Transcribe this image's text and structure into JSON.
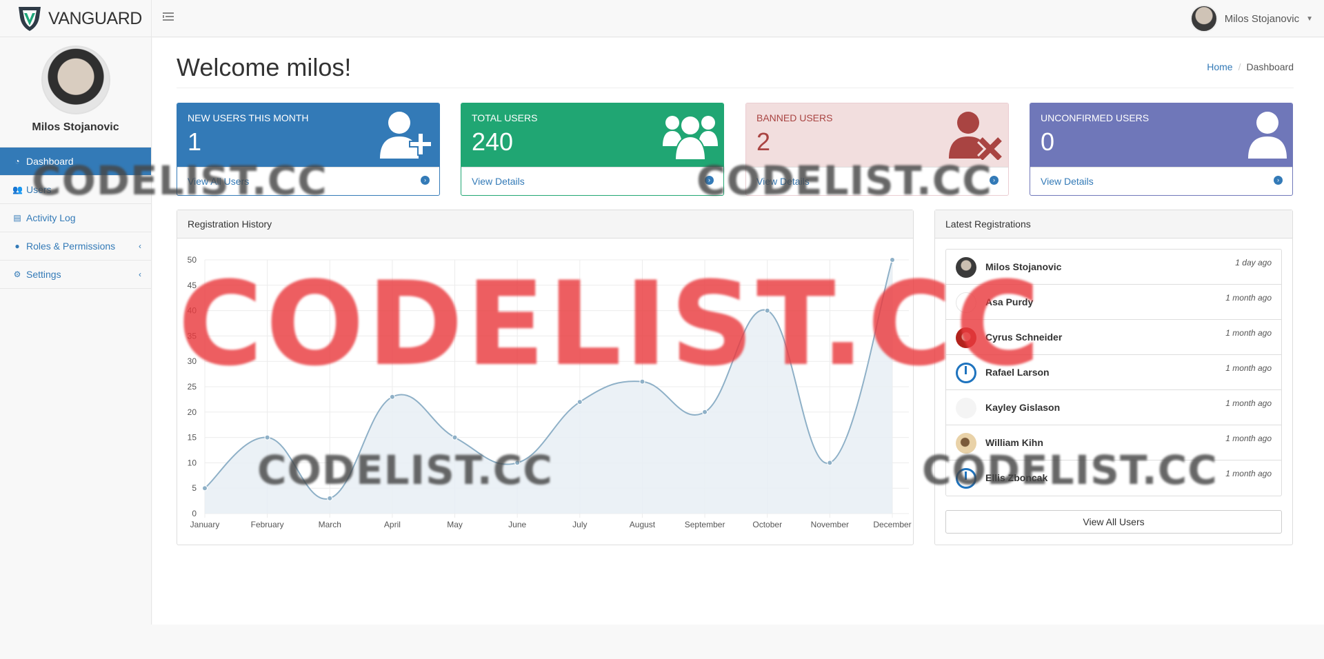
{
  "brand": {
    "name": "VANGUARD"
  },
  "topbar": {
    "user_name": "Milos Stojanovic"
  },
  "sidebar": {
    "profile_name": "Milos Stojanovic",
    "items": [
      {
        "label": "Dashboard",
        "icon": "dashboard-icon",
        "active": true
      },
      {
        "label": "Users",
        "icon": "users-icon"
      },
      {
        "label": "Activity Log",
        "icon": "list-icon"
      },
      {
        "label": "Roles & Permissions",
        "icon": "user-icon",
        "has_submenu": true
      },
      {
        "label": "Settings",
        "icon": "gear-icon",
        "has_submenu": true
      }
    ]
  },
  "page": {
    "title": "Welcome milos!"
  },
  "breadcrumb": {
    "home": "Home",
    "current": "Dashboard"
  },
  "stats": [
    {
      "label": "NEW USERS THIS MONTH",
      "value": "1",
      "link": "View All Users",
      "icon": "user-plus-icon",
      "color": "#337ab7"
    },
    {
      "label": "TOTAL USERS",
      "value": "240",
      "link": "View Details",
      "icon": "users-group-icon",
      "color": "#20a673"
    },
    {
      "label": "BANNED USERS",
      "value": "2",
      "link": "View Details",
      "icon": "user-times-icon",
      "color": "#a94442"
    },
    {
      "label": "UNCONFIRMED USERS",
      "value": "0",
      "link": "View Details",
      "icon": "user-icon",
      "color": "#6f77b9"
    }
  ],
  "registration_panel": {
    "title": "Registration History"
  },
  "chart_data": {
    "type": "area",
    "title": "",
    "categories": [
      "January",
      "February",
      "March",
      "April",
      "May",
      "June",
      "July",
      "August",
      "September",
      "October",
      "November",
      "December"
    ],
    "values": [
      5,
      15,
      3,
      23,
      15,
      10,
      22,
      26,
      20,
      40,
      10,
      50
    ],
    "ylim": [
      0,
      50
    ],
    "yticks": [
      0,
      5,
      10,
      15,
      20,
      25,
      30,
      35,
      40,
      45,
      50
    ],
    "grid": true,
    "line_color": "#8eb0c7",
    "fill_color": "#e8eff4"
  },
  "latest": {
    "title": "Latest Registrations",
    "users": [
      {
        "name": "Milos Stojanovic",
        "time": "1 day ago",
        "avatar": "photo"
      },
      {
        "name": "Asa Purdy",
        "time": "1 month ago",
        "avatar": "blank"
      },
      {
        "name": "Cyrus Schneider",
        "time": "1 month ago",
        "avatar": "red"
      },
      {
        "name": "Rafael Larson",
        "time": "1 month ago",
        "avatar": "power"
      },
      {
        "name": "Kayley Gislason",
        "time": "1 month ago",
        "avatar": "blank"
      },
      {
        "name": "William Kihn",
        "time": "1 month ago",
        "avatar": "warm"
      },
      {
        "name": "Ellis Zboncak",
        "time": "1 month ago",
        "avatar": "power"
      }
    ],
    "view_all_label": "View All Users"
  },
  "watermarks": {
    "text": "CODELIST.CC"
  }
}
